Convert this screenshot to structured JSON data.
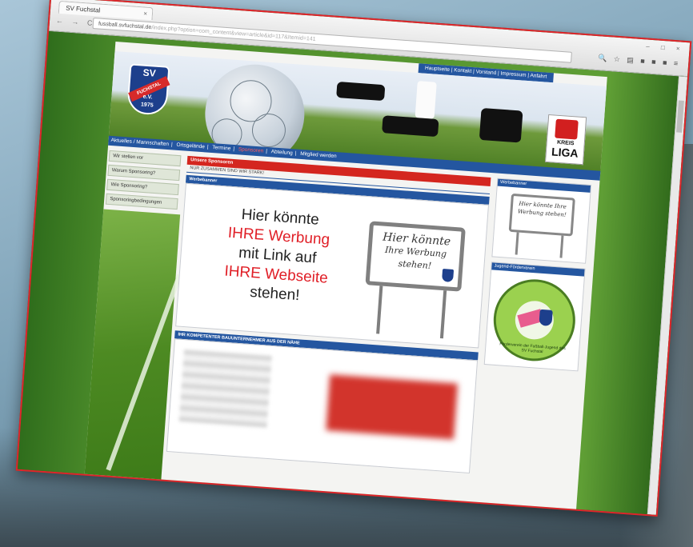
{
  "browser": {
    "tab_title": "SV Fuchstal",
    "tab_close": "×",
    "nav_buttons": "← → C",
    "url_host": "fussball.svfuchstal.de",
    "url_path": "/index.php?option=com_content&view=article&id=117&Itemid=141",
    "ext_icons": "🔍 ☆ ▤ ■ ■ ■ ≡",
    "window_controls": "– □ ×"
  },
  "site": {
    "top_nav": "Hauptseite  |  Kontakt  |  Vorstand  |  Impressum  |  Anfahrt",
    "crest": {
      "sv": "SV",
      "name": "FUCHSTAL",
      "ev": "e.V.",
      "year": "1975"
    },
    "liga_badge": {
      "kreis": "KREIS",
      "liga": "LIGA"
    },
    "sub_nav": [
      "Aktuelles / Mannschaften",
      "Ortsgelände",
      "Termine",
      "Sponsoren",
      "Abteilung",
      "Mitglied werden"
    ],
    "sidebar_items": [
      "Wir stellen vor",
      "Warum Sponsoring?",
      "Wie Sponsoring?",
      "Sponsoringbedingungen"
    ],
    "main": {
      "section_title": "Unsere Sponsoren",
      "section_subtitle": "NUR ZUSAMMEN SIND WIR STARK!",
      "werbebanner_header": "Werbebanner",
      "ad_line1": "Hier könnte",
      "ad_line2": "IHRE Werbung",
      "ad_line3": "mit Link auf",
      "ad_line4": "IHRE Webseite",
      "ad_line5": "stehen!",
      "sign_line1": "Hier könnte",
      "sign_line2": "Ihre Werbung",
      "sign_line3": "stehen!",
      "second_header": "IHR KOMPETENTER BAUUNTERNEHMER AUS DER NÄHE"
    },
    "right_col": {
      "box1_header": "Werbebanner",
      "box1_sign": "Hier könnte Ihre Werbung stehen!",
      "box2_header": "Jugend-Förderverein",
      "logo_text": "Förderverein der Fußball-Jugend des SV Fuchstal"
    }
  },
  "colors": {
    "accent_blue": "#2456a0",
    "accent_red": "#d4261f",
    "frame_red": "#e0242b"
  }
}
